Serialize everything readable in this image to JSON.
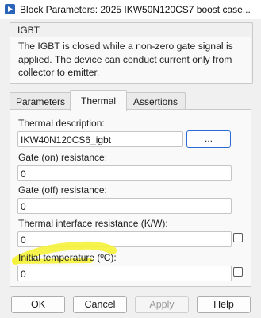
{
  "window": {
    "title": "Block Parameters: 2025 IKW50N120CS7 boost case..."
  },
  "group": {
    "legend": "IGBT",
    "description": "The IGBT is closed while a non-zero gate signal is applied. The device can conduct current only from collector to emitter."
  },
  "tabs": [
    {
      "label": "Parameters",
      "active": false
    },
    {
      "label": "Thermal",
      "active": true
    },
    {
      "label": "Assertions",
      "active": false
    }
  ],
  "fields": {
    "thermal_description": {
      "label": "Thermal description:",
      "value": "IKW40N120CS6_igbt",
      "browse_label": "..."
    },
    "gate_on": {
      "label": "Gate (on) resistance:",
      "value": "0"
    },
    "gate_off": {
      "label": "Gate (off) resistance:",
      "value": "0"
    },
    "thermal_interface": {
      "label": "Thermal interface resistance (K/W):",
      "value": "0",
      "checked": false
    },
    "initial_temperature": {
      "label": "Initial temperature (ºC):",
      "value": "0",
      "checked": false
    }
  },
  "buttons": {
    "ok": "OK",
    "cancel": "Cancel",
    "apply": "Apply",
    "help": "Help"
  },
  "colors": {
    "accent": "#2b6ad4",
    "highlight": "#f5f23a"
  }
}
